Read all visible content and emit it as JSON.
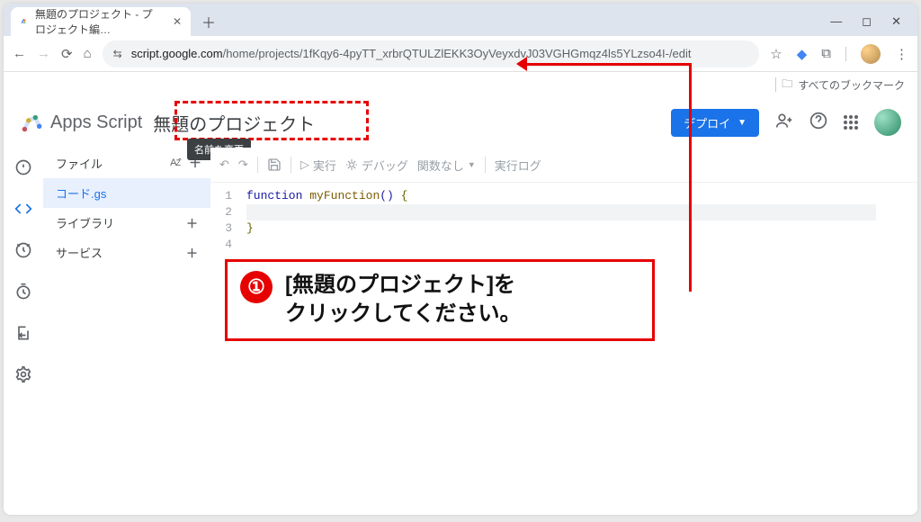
{
  "browser": {
    "tab_title": "無題のプロジェクト - プロジェクト編…",
    "url_host": "script.google.com",
    "url_path": "/home/projects/1fKqy6-4pyTT_xrbrQTULZlEKK3OyVeyxdvJ03VGHGmqz4ls5YLzso4I-/edit",
    "bookmarks_label": "すべてのブックマーク"
  },
  "header": {
    "product_name": "Apps Script",
    "project_title": "無題のプロジェクト",
    "rename_tooltip": "名前を変更",
    "deploy_label": "デプロイ"
  },
  "files_panel": {
    "files_label": "ファイル",
    "sort_label": "Aᴢ̂",
    "file_name": "コード.gs",
    "libraries_label": "ライブラリ",
    "services_label": "サービス"
  },
  "toolbar": {
    "undo": "↶",
    "redo": "↷",
    "save": "🗎",
    "run_label": "実行",
    "debug_label": "デバッグ",
    "func_select": "関数なし",
    "exec_log": "実行ログ"
  },
  "code": {
    "lines": [
      "1",
      "2",
      "3",
      "4"
    ],
    "l1_a": "function",
    "l1_b": "myFunction",
    "l1_c": "()",
    "l1_d": "{",
    "l3": "}"
  },
  "annotation": {
    "number": "①",
    "text_line1": "[無題のプロジェクト]を",
    "text_line2": "クリックしてください。"
  }
}
